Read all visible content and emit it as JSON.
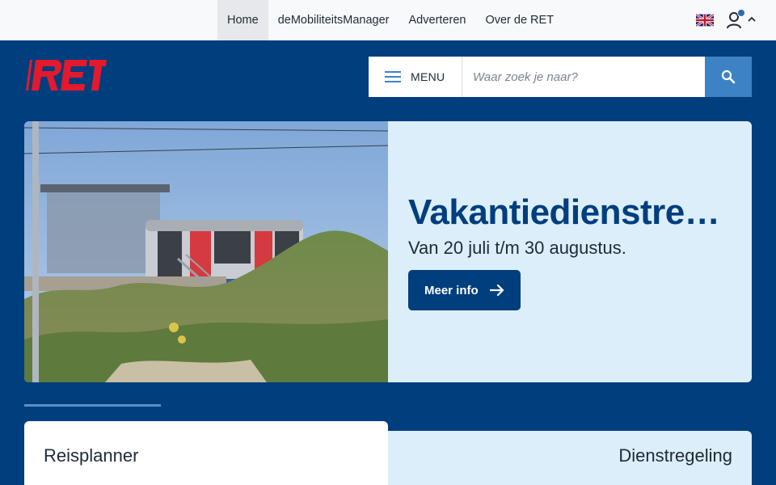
{
  "topnav": {
    "items": [
      {
        "label": "Home",
        "active": true
      },
      {
        "label": "deMobiliteitsManager",
        "active": false
      },
      {
        "label": "Adverteren",
        "active": false
      },
      {
        "label": "Over de RET",
        "active": false
      }
    ],
    "language_icon": "uk-flag-icon",
    "account_icon": "user-icon"
  },
  "header": {
    "logo_text": "RET",
    "menu_label": "MENU",
    "search_placeholder": "Waar zoek je naar?",
    "search_icon": "search-icon"
  },
  "hero": {
    "title": "Vakantiedienstregeling",
    "subtitle": "Van 20 juli t/m 30 augustus.",
    "cta_label": "Meer info"
  },
  "tabs": [
    {
      "label": "Reisplanner",
      "active": true
    },
    {
      "label": "Dienstregeling",
      "active": false
    }
  ],
  "colors": {
    "brand_blue": "#003e7e",
    "brand_red": "#e3192d",
    "accent_blue": "#3e82c6",
    "light_blue": "#dbeefa"
  }
}
